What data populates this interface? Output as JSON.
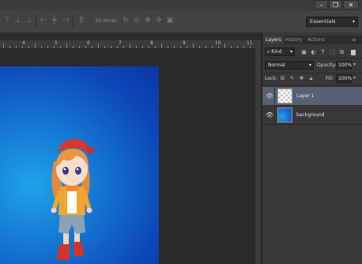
{
  "window": {
    "minimize_icon": "minimize-icon",
    "restore_icon": "restore-icon",
    "close_icon": "close-icon"
  },
  "options_bar": {
    "mode_3d_label": "3D Mode:",
    "workspace": "Essentials"
  },
  "ruler": {
    "labels": [
      "4",
      "5",
      "6",
      "7",
      "8",
      "9",
      "10",
      "11"
    ]
  },
  "layers_panel": {
    "tabs": [
      "Layers",
      "History",
      "Actions"
    ],
    "active_tab": "Layers",
    "filter": "Kind",
    "blend_mode": "Normal",
    "opacity_label": "Opacity:",
    "opacity_value": "100%",
    "lock_label": "Lock:",
    "fill_label": "Fill:",
    "fill_value": "100%",
    "layers": [
      {
        "name": "Layer 1",
        "selected": true,
        "visible": true,
        "thumb": "transparent"
      },
      {
        "name": "background",
        "selected": false,
        "visible": true,
        "thumb": "blue-gradient"
      }
    ]
  },
  "colors": {
    "canvas_blue": "#1479d4",
    "panel_bg": "#383838",
    "selected_row": "#566273"
  }
}
